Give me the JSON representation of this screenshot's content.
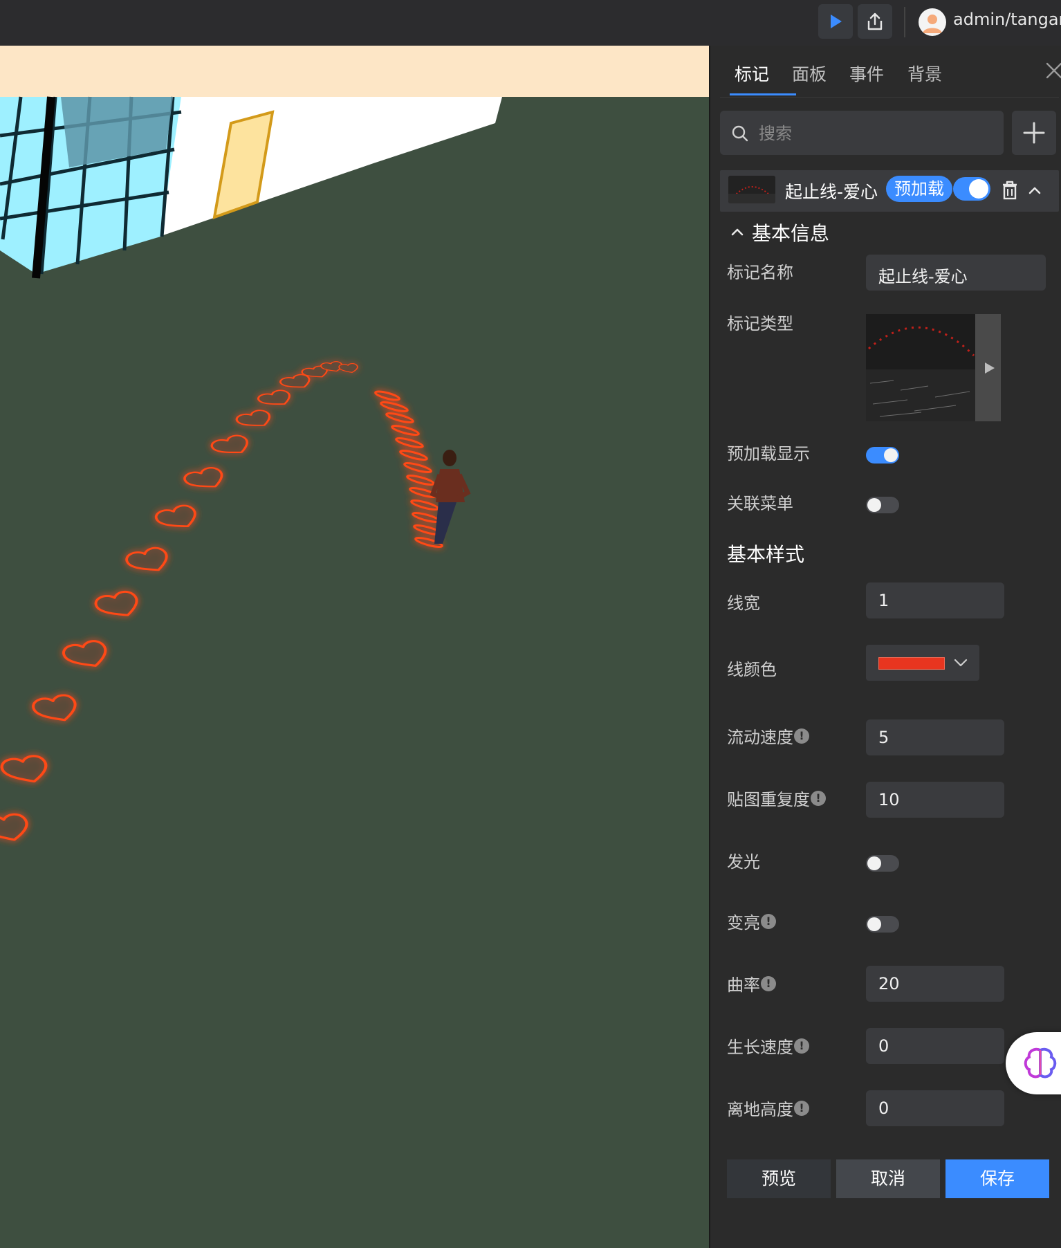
{
  "topbar": {
    "play_icon": "play-icon",
    "share_icon": "share-icon",
    "user": "admin/tangan"
  },
  "panel": {
    "tabs": [
      {
        "label": "标记",
        "active": true
      },
      {
        "label": "面板",
        "active": false
      },
      {
        "label": "事件",
        "active": false
      },
      {
        "label": "背景",
        "active": false
      }
    ],
    "search_placeholder": "搜索",
    "marker": {
      "name": "起止线-爱心",
      "badge": "预加载",
      "enabled": true
    },
    "basic_info": {
      "title": "基本信息",
      "name_label": "标记名称",
      "name_value": "起止线-爱心",
      "type_label": "标记类型",
      "preload_label": "预加载显示",
      "preload_on": true,
      "menu_label": "关联菜单",
      "menu_on": false
    },
    "basic_style": {
      "title": "基本样式",
      "line_width_label": "线宽",
      "line_width": "1",
      "line_color_label": "线颜色",
      "line_color": "#e8351f",
      "flow_speed_label": "流动速度",
      "flow_speed": "5",
      "repeat_label": "贴图重复度",
      "repeat": "10",
      "glow_label": "发光",
      "glow_on": false,
      "bright_label": "变亮",
      "bright_on": false,
      "curvature_label": "曲率",
      "curvature": "20",
      "growth_label": "生长速度",
      "growth": "0",
      "height_label": "离地高度",
      "height": "0"
    },
    "buttons": {
      "preview": "预览",
      "cancel": "取消",
      "save": "保存"
    }
  },
  "colors": {
    "accent": "#3b8cff",
    "ground": "#3e4e3f",
    "heart": "#ff4a12"
  }
}
